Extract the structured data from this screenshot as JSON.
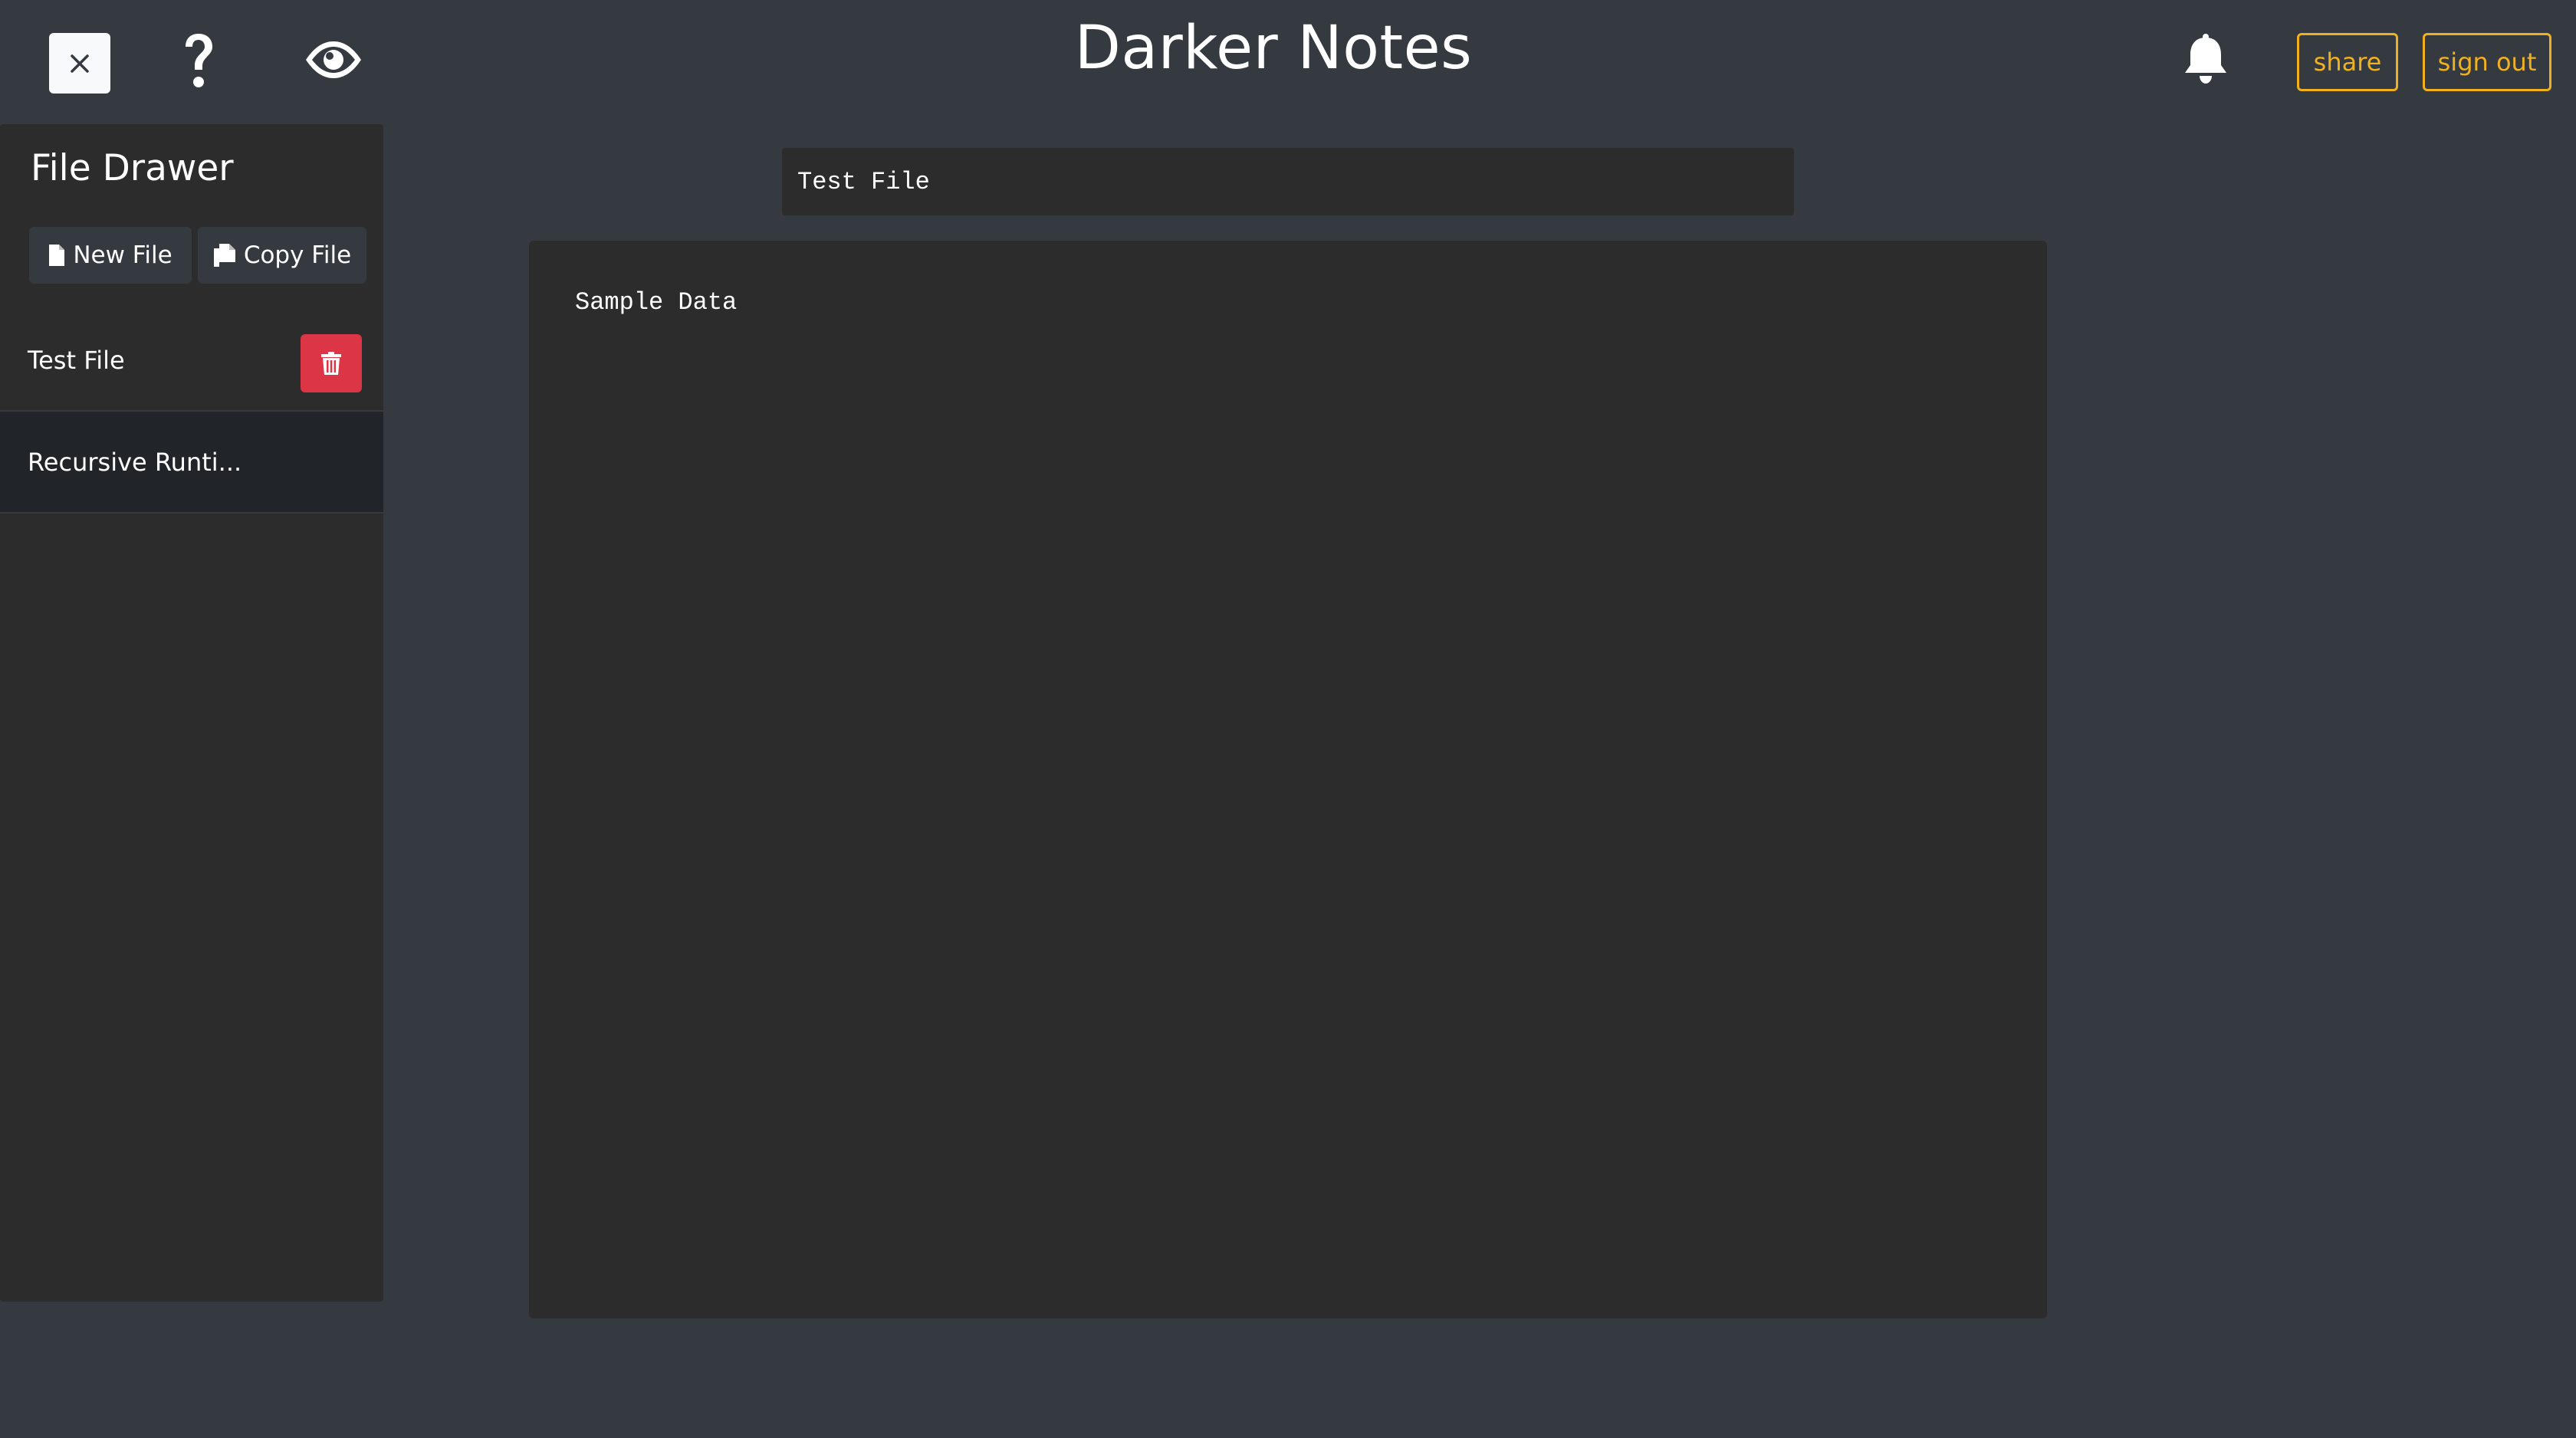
{
  "header": {
    "title": "Darker Notes",
    "close_icon": "close-icon",
    "help_icon": "question-icon",
    "preview_icon": "eye-icon",
    "notification_icon": "bell-icon",
    "share_label": "share",
    "signout_label": "sign out"
  },
  "sidebar": {
    "title": "File Drawer",
    "new_file_label": "New File",
    "copy_file_label": "Copy File",
    "files": [
      {
        "name": "Test File"
      },
      {
        "name": "Recursive Runti..."
      }
    ]
  },
  "editor": {
    "title_value": "Test File",
    "body_value": "Sample Data"
  },
  "colors": {
    "background": "#343a40",
    "panel": "#2c2c2c",
    "accent": "#f0b020",
    "danger": "#dc3545"
  }
}
